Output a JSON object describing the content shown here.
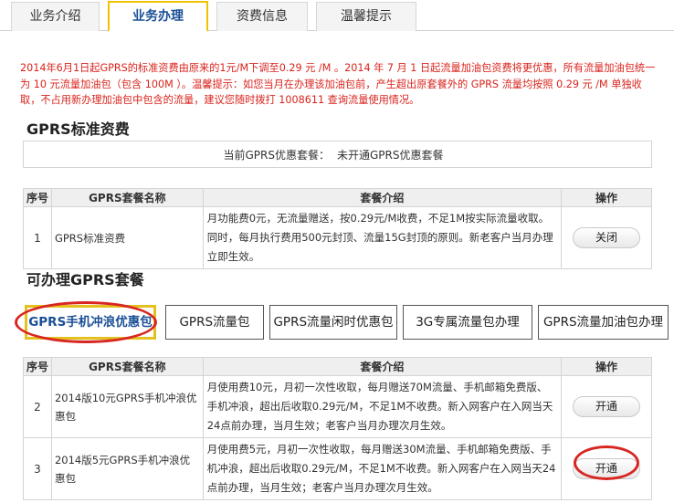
{
  "tabs": [
    {
      "label": "业务介绍",
      "active": false
    },
    {
      "label": "业务办理",
      "active": true
    },
    {
      "label": "资费信息",
      "active": false
    },
    {
      "label": "温馨提示",
      "active": false
    }
  ],
  "notice": "2014年6月1日起GPRS的标准资费由原来的1元/M下调至0.29 元 /M 。2014 年 7 月 1 日起流量加油包资费将更优惠，所有流量加油包统一为 10 元流量加油包（包含 100M ）。温馨提示：如您当月在办理该加油包前，产生超出原套餐外的 GPRS 流量均按照 0.29 元 /M 单独收取，不占用新办理加油包中包含的流量，建议您随时拨打 1008611 查询流量使用情况。",
  "standard_section": {
    "title": "GPRS标准资费",
    "current_label": "当前GPRS优惠套餐：",
    "current_value": "未开通GPRS优惠套餐"
  },
  "table_headers": {
    "seq": "序号",
    "name": "GPRS套餐名称",
    "intro": "套餐介绍",
    "op": "操作"
  },
  "standard_rows": [
    {
      "seq": "1",
      "name": "GPRS标准资费",
      "intro": "月功能费0元，无流量赠送，按0.29元/M收费，不足1M按实际流量收取。同时，每月执行费用500元封顶、流量15G封顶的原则。新老客户当月办理立即生效。",
      "button": "关闭"
    }
  ],
  "available_section": {
    "title": "可办理GPRS套餐"
  },
  "package_tabs": [
    {
      "label": "GPRS手机冲浪优惠包",
      "active": true
    },
    {
      "label": "GPRS流量包",
      "active": false
    },
    {
      "label": "GPRS流量闲时优惠包",
      "active": false
    },
    {
      "label": "3G专属流量包办理",
      "active": false
    },
    {
      "label": "GPRS流量加油包办理",
      "active": false
    }
  ],
  "package_rows": [
    {
      "seq": "2",
      "name": "2014版10元GPRS手机冲浪优惠包",
      "intro": "月使用费10元，月初一次性收取，每月赠送70M流量、手机邮箱免费版、手机冲浪，超出后收取0.29元/M，不足1M不收费。新入网客户在入网当天24点前办理，当月生效；老客户当月办理次月生效。",
      "button": "开通"
    },
    {
      "seq": "3",
      "name": "2014版5元GPRS手机冲浪优惠包",
      "intro": "月使用费5元，月初一次性收取，每月赠送30M流量、手机邮箱免费版、手机冲浪，超出后收取0.29元/M，不足1M不收费。新入网客户在入网当天24点前办理，当月生效；老客户当月办理次月生效。",
      "button": "开通"
    }
  ],
  "colors": {
    "notice_red": "#d9231c",
    "tab_accent": "#f2c200",
    "highlight_ellipse": "#d82621",
    "link_blue": "#1a4f97"
  }
}
